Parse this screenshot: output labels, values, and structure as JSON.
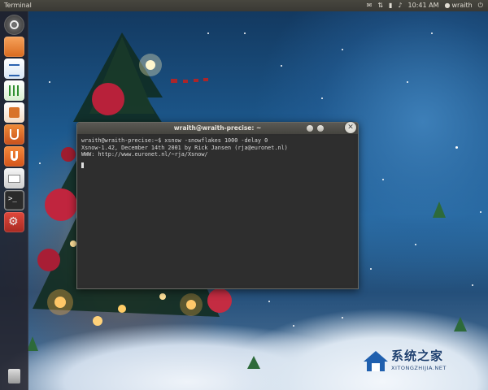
{
  "top_panel": {
    "window_title": "Terminal",
    "time": "10:41 AM",
    "user": "wraith"
  },
  "launcher": {
    "items": [
      {
        "name": "dash-home-icon"
      },
      {
        "name": "files-icon"
      },
      {
        "name": "writer-icon"
      },
      {
        "name": "calc-icon"
      },
      {
        "name": "impress-icon"
      },
      {
        "name": "software-center-icon"
      },
      {
        "name": "mail-icon"
      },
      {
        "name": "terminal-icon"
      },
      {
        "name": "settings-icon"
      },
      {
        "name": "trash-icon"
      }
    ]
  },
  "terminal": {
    "title": "wraith@wraith-precise: ~",
    "lines": [
      "wraith@wraith-precise:~$ xsnow -snowflakes 1000 -delay 0",
      "Xsnow-1.42, December 14th 2001 by Rick Jansen (rja@euronet.nl)",
      "WWW: http://www.euronet.nl/~rja/Xsnow/"
    ]
  },
  "watermark": {
    "main": "系统之家",
    "sub": "XITONGZHIJIA.NET"
  }
}
